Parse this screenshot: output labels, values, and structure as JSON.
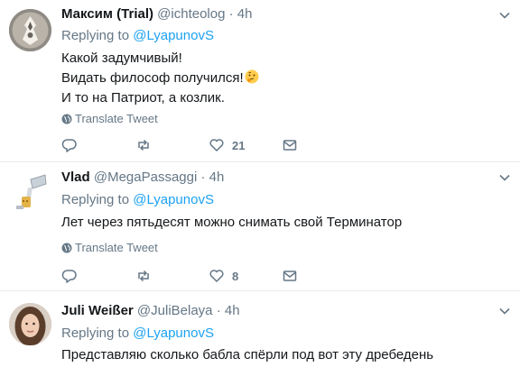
{
  "tweets": [
    {
      "fullname": "Максим (Trial)",
      "handle": "@ichteolog",
      "dot": "·",
      "time": "4h",
      "replying_prefix": "Replying to ",
      "replying_to": "@LyapunovS",
      "lines": [
        "Какой задумчивый!",
        "Видать философ получился!",
        "И то на Патриот, а козлик."
      ],
      "emoji": "thinking-face-emoji",
      "translate": "Translate Tweet",
      "likes": "21"
    },
    {
      "fullname": "Vlad",
      "handle": "@MegaPassaggi",
      "dot": "·",
      "time": "4h",
      "replying_prefix": "Replying to ",
      "replying_to": "@LyapunovS",
      "lines": [
        "Лет через пятьдесят можно снимать свой Терминатор"
      ],
      "translate": "Translate Tweet",
      "likes": "8"
    },
    {
      "fullname": "Juli Weißer",
      "handle": "@JuliBelaya",
      "dot": "·",
      "time": "4h",
      "replying_prefix": "Replying to ",
      "replying_to": "@LyapunovS",
      "lines": [
        "Представляю сколько бабла спёрли под вот эту дребедень"
      ]
    }
  ],
  "colors": {
    "link": "#1da1f2",
    "secondary": "#657786",
    "border": "#e6ecf0"
  }
}
